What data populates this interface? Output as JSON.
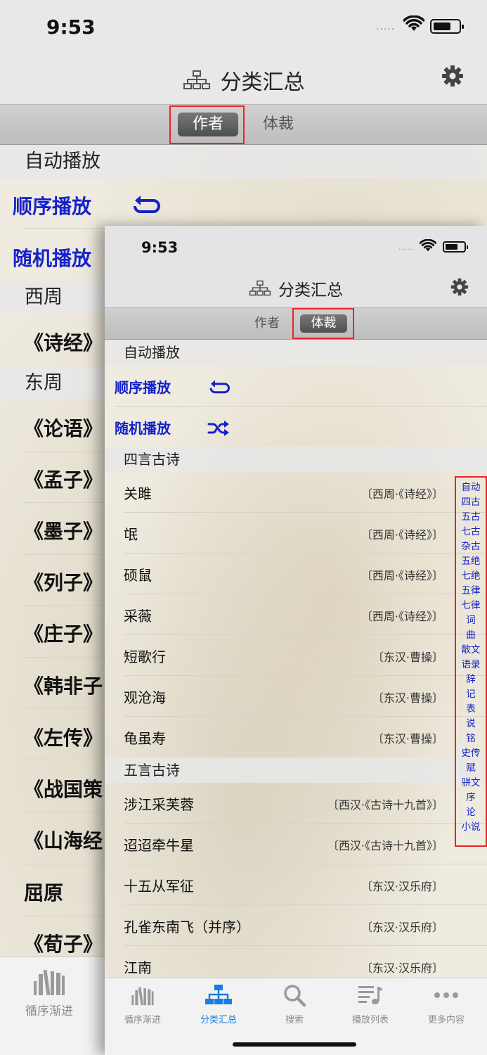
{
  "background_screen": {
    "status": {
      "time": "9:53",
      "signal": "....."
    },
    "nav": {
      "title": "分类汇总"
    },
    "segment": {
      "author": "作者",
      "genre": "体裁",
      "selected": "author"
    },
    "auto_play_header": "自动播放",
    "sequential_play": "顺序播放",
    "random_play": "随机播放",
    "sections": [
      {
        "header": "西周",
        "items": [
          "《诗经》"
        ]
      },
      {
        "header": "东周",
        "items": [
          "《论语》",
          "《孟子》",
          "《墨子》",
          "《列子》",
          "《庄子》",
          "《韩非子",
          "《左传》",
          "《战国策",
          "《山海经"
        ]
      }
    ],
    "extra_rows": [
      "屈原",
      "《荀子》"
    ],
    "tabbar": {
      "label": "循序渐进"
    }
  },
  "foreground_screen": {
    "status": {
      "time": "9:53",
      "signal": "....."
    },
    "nav": {
      "title": "分类汇总"
    },
    "segment": {
      "author": "作者",
      "genre": "体裁",
      "selected": "genre"
    },
    "auto_play_header": "自动播放",
    "sequential_play": "顺序播放",
    "random_play": "随机播放",
    "sections": [
      {
        "header": "四言古诗",
        "rows": [
          {
            "title": "关雎",
            "source": "〔西周·《诗经》〕"
          },
          {
            "title": "氓",
            "source": "〔西周·《诗经》〕"
          },
          {
            "title": "硕鼠",
            "source": "〔西周·《诗经》〕"
          },
          {
            "title": "采薇",
            "source": "〔西周·《诗经》〕"
          },
          {
            "title": "短歌行",
            "source": "〔东汉·曹操〕"
          },
          {
            "title": "观沧海",
            "source": "〔东汉·曹操〕"
          },
          {
            "title": "龟虽寿",
            "source": "〔东汉·曹操〕"
          }
        ]
      },
      {
        "header": "五言古诗",
        "rows": [
          {
            "title": "涉江采芙蓉",
            "source": "〔西汉·《古诗十九首》〕"
          },
          {
            "title": "迢迢牵牛星",
            "source": "〔西汉·《古诗十九首》〕"
          },
          {
            "title": "十五从军征",
            "source": "〔东汉·汉乐府〕"
          },
          {
            "title": "孔雀东南飞（并序）",
            "source": "〔东汉·汉乐府〕"
          },
          {
            "title": "江南",
            "source": "〔东汉·汉乐府〕"
          }
        ]
      }
    ],
    "section_index": [
      "自动",
      "四古",
      "五古",
      "七古",
      "杂古",
      "五绝",
      "七绝",
      "五律",
      "七律",
      "词",
      "曲",
      "散文",
      "语录",
      "辞",
      "记",
      "表",
      "说",
      "铭",
      "史传",
      "赋",
      "骈文",
      "序",
      "论",
      "小说"
    ],
    "tabbar": [
      {
        "label": "循序渐进",
        "icon": "books-icon",
        "active": false
      },
      {
        "label": "分类汇总",
        "icon": "hierarchy-icon",
        "active": true
      },
      {
        "label": "搜索",
        "icon": "search-icon",
        "active": false
      },
      {
        "label": "播放列表",
        "icon": "playlist-icon",
        "active": false
      },
      {
        "label": "更多内容",
        "icon": "more-icon",
        "active": false
      }
    ]
  },
  "colors": {
    "link_blue": "#1522c8",
    "tab_active_blue": "#1a7be0",
    "highlight_red": "#e8242c"
  }
}
